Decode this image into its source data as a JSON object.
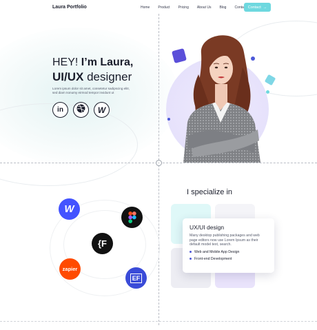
{
  "header": {
    "logo": "Laura Portfolio",
    "nav": [
      "Home",
      "Product",
      "Pricing",
      "About Us",
      "Blog",
      "Contact"
    ],
    "contact_button": "Contact"
  },
  "hero": {
    "greeting": "HEY!",
    "name_line": "I’m Laura,",
    "role_bold": "UI/UX",
    "role_rest": "designer",
    "description": "Lorem ipsum dolor sit amet, consetetur sadipscing elitr, sed diam nonumy eirmod tempor invidunt ut"
  },
  "socials": [
    {
      "icon": "linkedin-icon",
      "glyph": "in"
    },
    {
      "icon": "dribbble-icon",
      "glyph": ""
    },
    {
      "icon": "webflow-icon",
      "glyph": "W"
    }
  ],
  "apps": [
    {
      "icon": "webflow-app-icon",
      "glyph": "W",
      "color": "#4353ff"
    },
    {
      "icon": "figma-app-icon",
      "glyph": "",
      "color": "#111111"
    },
    {
      "icon": "framer-app-icon",
      "glyph": "{F",
      "color": "#111111"
    },
    {
      "icon": "zapier-app-icon",
      "glyph": "zapier",
      "color": "#ff4a00"
    },
    {
      "icon": "elementor-app-icon",
      "glyph": "EF",
      "color": "#3a4bd8"
    }
  ],
  "specialize": {
    "title": "I specialize in",
    "card_title": "UX/UI design",
    "card_desc": "Many desktop publishing packages and web page editors now use Lorem Ipsum as their default model text, search.",
    "bullets": [
      "Web and Mobile App Design",
      "Front-end Development"
    ]
  },
  "colors": {
    "accent": "#6ed8df",
    "brand": "#4c58d8",
    "lilac": "#e3defb"
  }
}
